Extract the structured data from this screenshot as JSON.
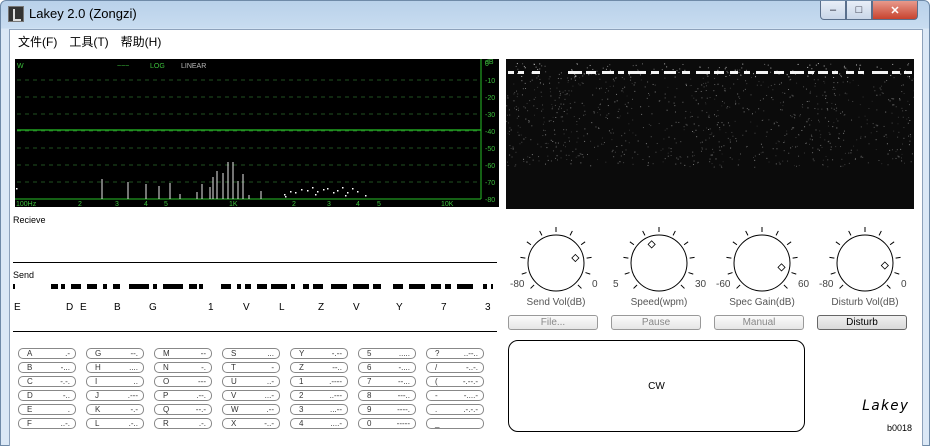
{
  "window": {
    "title": "Lakey 2.0 (Zongzi)",
    "min_glyph": "–",
    "max_glyph": "□",
    "close_glyph": "✕"
  },
  "menu": [
    "文件(F)",
    "工具(T)",
    "帮助(H)"
  ],
  "spectrum": {
    "top_labels": {
      "w": "W",
      "wave": "~~~",
      "log": "LOG",
      "linear": "LINEAR"
    },
    "db_unit": "dB",
    "db_ticks": [
      "0",
      "-10",
      "-20",
      "-30",
      "-40",
      "-50",
      "-60",
      "-70",
      "-80"
    ],
    "freq_ticks": [
      "100Hz",
      "2",
      "3",
      "4",
      "5",
      "1K",
      "2",
      "3",
      "4",
      "5",
      "10K"
    ]
  },
  "receive": {
    "label": "Recieve"
  },
  "send": {
    "label": "Send",
    "letters": [
      "E",
      "D",
      "E",
      "B",
      "G",
      "1",
      "V",
      "L",
      "Z",
      "V",
      "Y",
      "7",
      "3"
    ]
  },
  "knobs": [
    {
      "caption": "Send Vol(dB)",
      "min": "-80",
      "max": "0",
      "level": 0.78
    },
    {
      "caption": "Speed(wpm)",
      "min": "5",
      "max": "30",
      "level": 0.42
    },
    {
      "caption": "Spec Gain(dB)",
      "min": "-60",
      "max": "60",
      "level": 0.88
    },
    {
      "caption": "Disturb Vol(dB)",
      "min": "-80",
      "max": "0",
      "level": 0.86
    }
  ],
  "buttons": {
    "file": "File...",
    "pause": "Pause",
    "manual": "Manual",
    "disturb": "Disturb"
  },
  "cw_label": "CW",
  "logo": "Lakey",
  "version": "b0018",
  "code_table": [
    [
      {
        "ch": "A",
        "code": ".-"
      },
      {
        "ch": "B",
        "code": "-..."
      },
      {
        "ch": "C",
        "code": "-.-."
      },
      {
        "ch": "D",
        "code": "-.."
      },
      {
        "ch": "E",
        "code": "."
      },
      {
        "ch": "F",
        "code": "..-."
      }
    ],
    [
      {
        "ch": "G",
        "code": "--."
      },
      {
        "ch": "H",
        "code": "...."
      },
      {
        "ch": "I",
        "code": ".."
      },
      {
        "ch": "J",
        "code": ".---"
      },
      {
        "ch": "K",
        "code": "-.-"
      },
      {
        "ch": "L",
        "code": ".-.."
      }
    ],
    [
      {
        "ch": "M",
        "code": "--"
      },
      {
        "ch": "N",
        "code": "-."
      },
      {
        "ch": "O",
        "code": "---"
      },
      {
        "ch": "P",
        "code": ".--."
      },
      {
        "ch": "Q",
        "code": "--.-"
      },
      {
        "ch": "R",
        "code": ".-."
      }
    ],
    [
      {
        "ch": "S",
        "code": "..."
      },
      {
        "ch": "T",
        "code": "-"
      },
      {
        "ch": "U",
        "code": "..-"
      },
      {
        "ch": "V",
        "code": "...-"
      },
      {
        "ch": "W",
        "code": ".--"
      },
      {
        "ch": "X",
        "code": "-..-"
      }
    ],
    [
      {
        "ch": "Y",
        "code": "-.--"
      },
      {
        "ch": "Z",
        "code": "--.."
      },
      {
        "ch": "1",
        "code": ".----"
      },
      {
        "ch": "2",
        "code": "..---"
      },
      {
        "ch": "3",
        "code": "...--"
      },
      {
        "ch": "4",
        "code": "....-"
      }
    ],
    [
      {
        "ch": "5",
        "code": "....."
      },
      {
        "ch": "6",
        "code": "-...."
      },
      {
        "ch": "7",
        "code": "--..."
      },
      {
        "ch": "8",
        "code": "---.."
      },
      {
        "ch": "9",
        "code": "----."
      },
      {
        "ch": "0",
        "code": "-----"
      }
    ],
    [
      {
        "ch": "?",
        "code": "..--.."
      },
      {
        "ch": "/",
        "code": "-..-."
      },
      {
        "ch": "(",
        "code": "-.--.-"
      },
      {
        "ch": "-",
        "code": "-....-"
      },
      {
        "ch": ".",
        "code": ".-.-.-"
      },
      {
        "ch": "_",
        "code": ""
      }
    ]
  ]
}
